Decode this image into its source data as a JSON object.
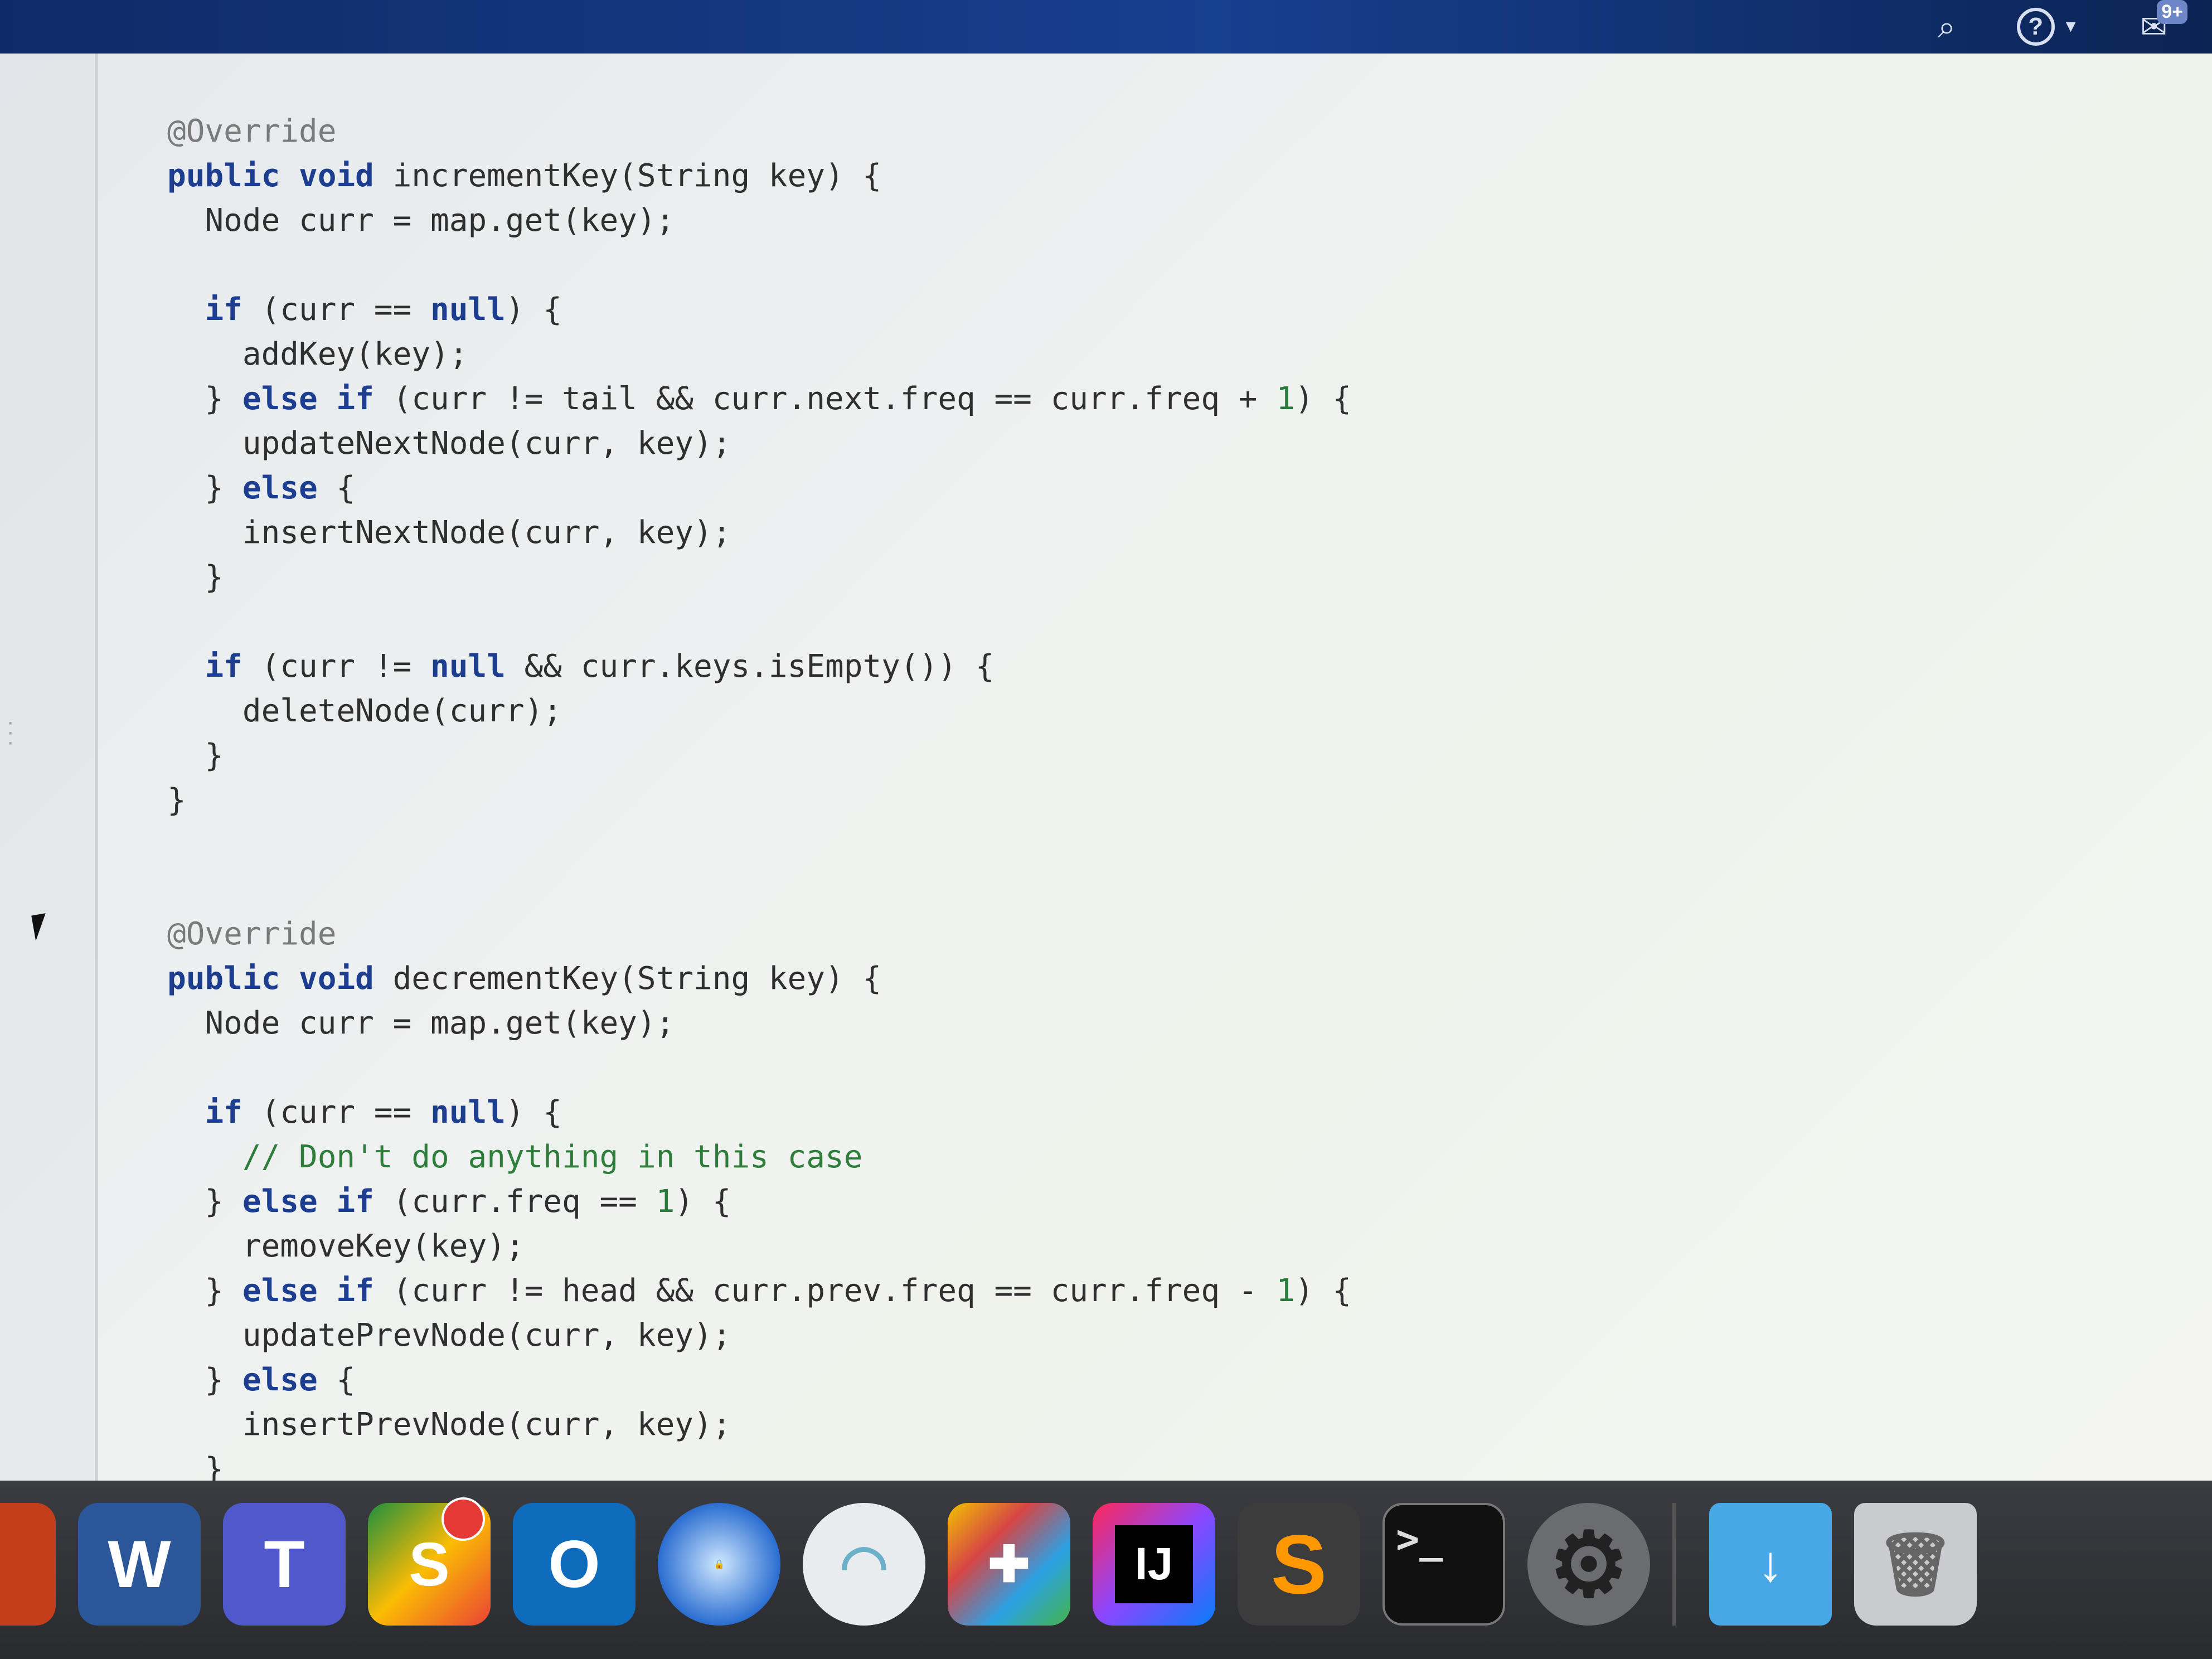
{
  "topbar": {
    "search_icon": "search-icon",
    "help_icon": "help-icon",
    "help_glyph": "?",
    "notifications_badge": "9+"
  },
  "code": {
    "lines": [
      [
        {
          "t": "@Override",
          "c": "ann"
        }
      ],
      [
        {
          "t": "public void",
          "c": "kw"
        },
        {
          "t": " incrementKey(String key) {",
          "c": "plain"
        }
      ],
      [
        {
          "t": "  Node curr = map.get(key);",
          "c": "plain"
        }
      ],
      [],
      [
        {
          "t": "  if",
          "c": "kw"
        },
        {
          "t": " (curr == ",
          "c": "plain"
        },
        {
          "t": "null",
          "c": "kw"
        },
        {
          "t": ") {",
          "c": "plain"
        }
      ],
      [
        {
          "t": "    addKey(key);",
          "c": "plain"
        }
      ],
      [
        {
          "t": "  } ",
          "c": "plain"
        },
        {
          "t": "else if",
          "c": "kw"
        },
        {
          "t": " (curr != tail && curr.next.freq == curr.freq + ",
          "c": "plain"
        },
        {
          "t": "1",
          "c": "num"
        },
        {
          "t": ") {",
          "c": "plain"
        }
      ],
      [
        {
          "t": "    updateNextNode(curr, key);",
          "c": "plain"
        }
      ],
      [
        {
          "t": "  } ",
          "c": "plain"
        },
        {
          "t": "else",
          "c": "kw"
        },
        {
          "t": " {",
          "c": "plain"
        }
      ],
      [
        {
          "t": "    insertNextNode(curr, key);",
          "c": "plain"
        }
      ],
      [
        {
          "t": "  }",
          "c": "plain"
        }
      ],
      [],
      [
        {
          "t": "  if",
          "c": "kw"
        },
        {
          "t": " (curr != ",
          "c": "plain"
        },
        {
          "t": "null",
          "c": "kw"
        },
        {
          "t": " && curr.keys.isEmpty()) {",
          "c": "plain"
        }
      ],
      [
        {
          "t": "    deleteNode(curr);",
          "c": "plain"
        }
      ],
      [
        {
          "t": "  }",
          "c": "plain"
        }
      ],
      [
        {
          "t": "}",
          "c": "plain"
        }
      ],
      [],
      [],
      [
        {
          "t": "@Override",
          "c": "ann"
        }
      ],
      [
        {
          "t": "public void",
          "c": "kw"
        },
        {
          "t": " decrementKey(String key) {",
          "c": "plain"
        }
      ],
      [
        {
          "t": "  Node curr = map.get(key);",
          "c": "plain"
        }
      ],
      [],
      [
        {
          "t": "  if",
          "c": "kw"
        },
        {
          "t": " (curr == ",
          "c": "plain"
        },
        {
          "t": "null",
          "c": "kw"
        },
        {
          "t": ") {",
          "c": "plain"
        }
      ],
      [
        {
          "t": "    // Don't do anything in this case",
          "c": "cmt"
        }
      ],
      [
        {
          "t": "  } ",
          "c": "plain"
        },
        {
          "t": "else if",
          "c": "kw"
        },
        {
          "t": " (curr.freq == ",
          "c": "plain"
        },
        {
          "t": "1",
          "c": "num"
        },
        {
          "t": ") {",
          "c": "plain"
        }
      ],
      [
        {
          "t": "    removeKey(key);",
          "c": "plain"
        }
      ],
      [
        {
          "t": "  } ",
          "c": "plain"
        },
        {
          "t": "else if",
          "c": "kw"
        },
        {
          "t": " (curr != head && curr.prev.freq == curr.freq - ",
          "c": "plain"
        },
        {
          "t": "1",
          "c": "num"
        },
        {
          "t": ") {",
          "c": "plain"
        }
      ],
      [
        {
          "t": "    updatePrevNode(curr, key);",
          "c": "plain"
        }
      ],
      [
        {
          "t": "  } ",
          "c": "plain"
        },
        {
          "t": "else",
          "c": "kw"
        },
        {
          "t": " {",
          "c": "plain"
        }
      ],
      [
        {
          "t": "    insertPrevNode(curr, key);",
          "c": "plain"
        }
      ],
      [
        {
          "t": "  }",
          "c": "plain"
        }
      ]
    ]
  },
  "dock": {
    "items": [
      {
        "name": "powerpoint-icon",
        "glyph": "P"
      },
      {
        "name": "word-icon",
        "glyph": "W"
      },
      {
        "name": "teams-icon",
        "glyph": "T"
      },
      {
        "name": "sheets-icon",
        "glyph": "S"
      },
      {
        "name": "outlook-icon",
        "glyph": "O"
      },
      {
        "name": "vpn-icon",
        "glyph": "🔒"
      },
      {
        "name": "wifi-icon",
        "glyph": "◠"
      },
      {
        "name": "self-service-icon",
        "glyph": "✚"
      },
      {
        "name": "intellij-icon",
        "glyph": "IJ"
      },
      {
        "name": "sublime-text-icon",
        "glyph": "S"
      },
      {
        "name": "terminal-icon",
        "glyph": ">_"
      },
      {
        "name": "system-preferences-icon",
        "glyph": "⚙"
      },
      {
        "name": "downloads-folder-icon",
        "glyph": "↓"
      },
      {
        "name": "trash-icon",
        "glyph": "🗑"
      }
    ]
  }
}
